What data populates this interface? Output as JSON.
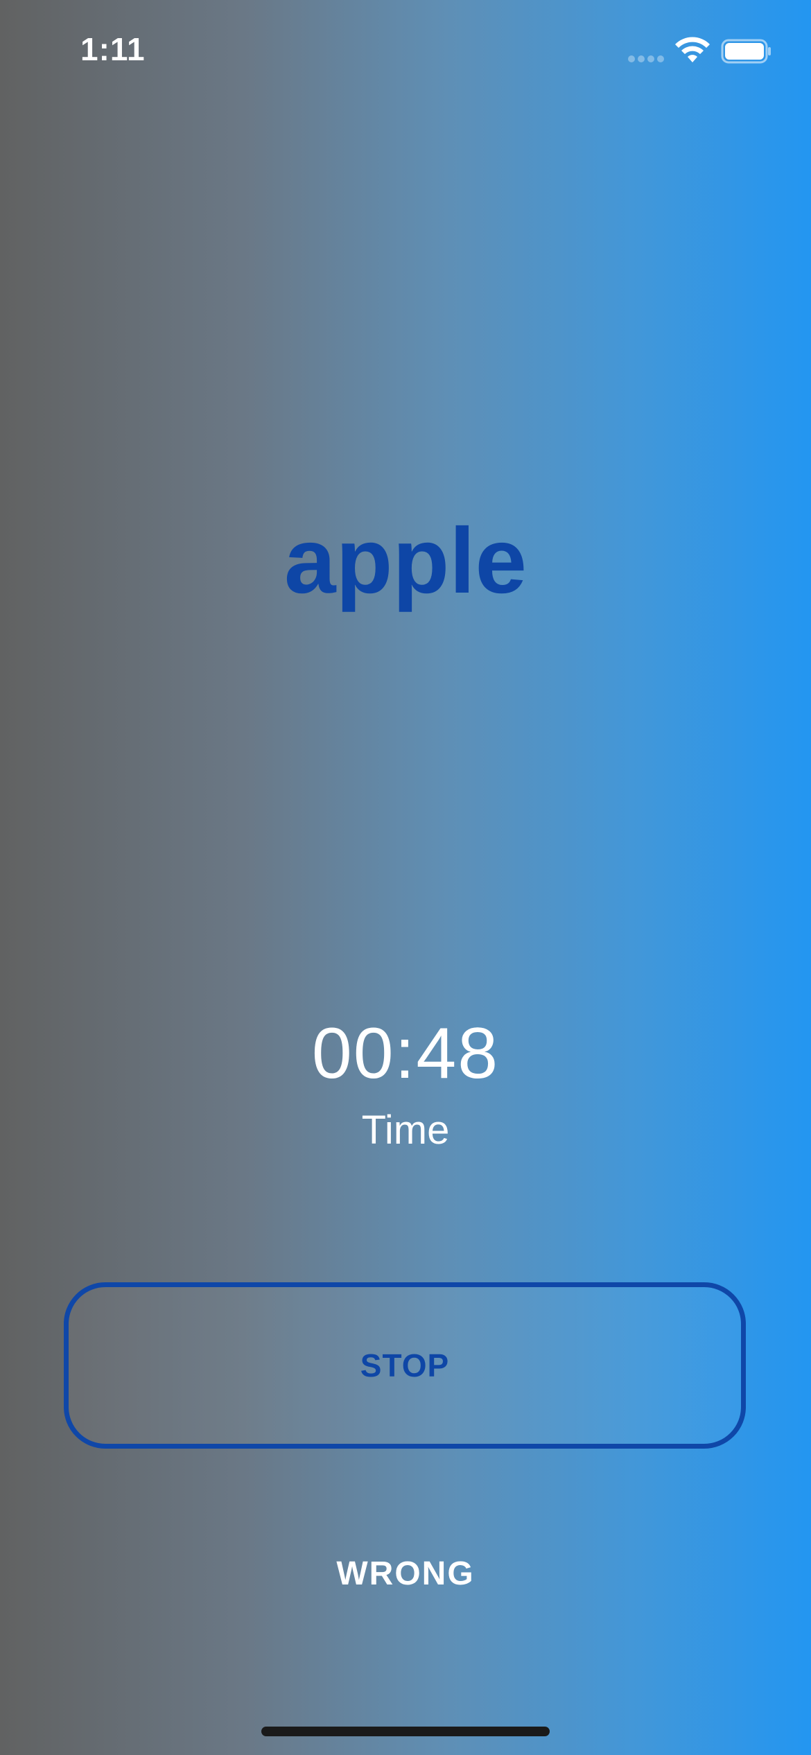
{
  "status_bar": {
    "time": "1:11",
    "signal_icon": "cellular-signal-dots-icon",
    "wifi_icon": "wifi-icon",
    "battery_icon": "battery-full-icon"
  },
  "card": {
    "word": "apple"
  },
  "timer": {
    "value": "00:48",
    "label": "Time"
  },
  "actions": {
    "stop_label": "STOP",
    "wrong_label": "WRONG"
  },
  "colors": {
    "word_blue": "#0e46a6",
    "button_border": "#0f47a8",
    "gradient_left": "#616262",
    "gradient_right": "#2396f1",
    "text_white": "#ffffff"
  }
}
